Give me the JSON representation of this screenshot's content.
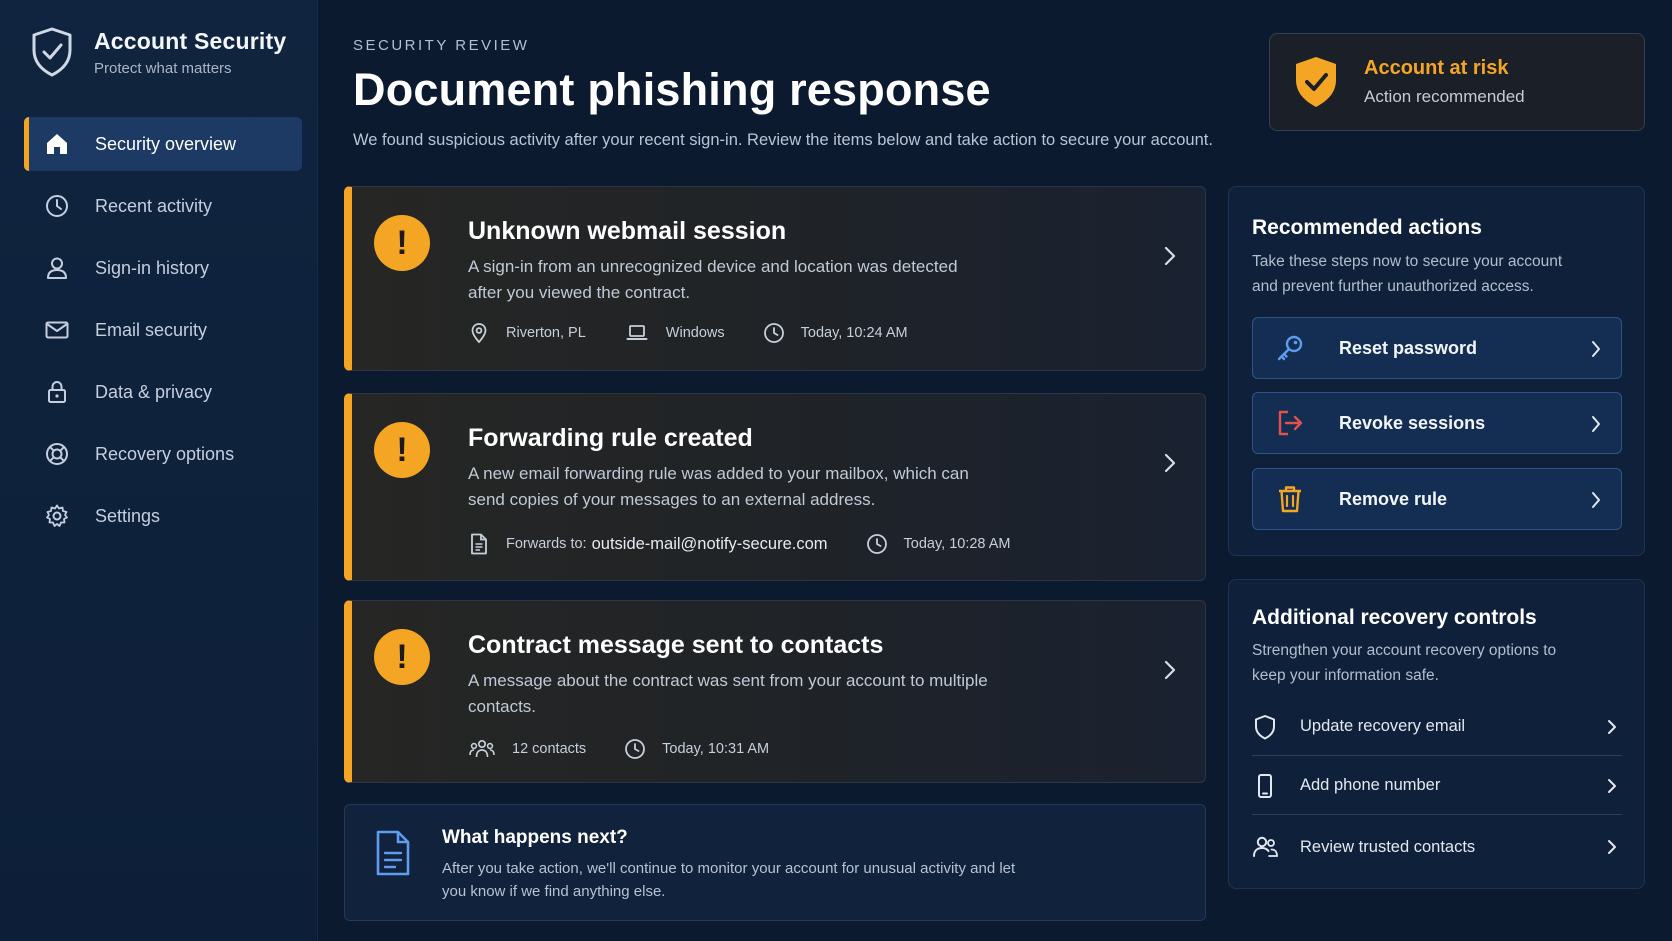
{
  "brand": {
    "title": "Account Security",
    "subtitle": "Protect what matters"
  },
  "nav": [
    {
      "label": "Security overview",
      "icon": "home-icon",
      "active": true
    },
    {
      "label": "Recent activity",
      "icon": "clock-icon",
      "active": false
    },
    {
      "label": "Sign-in history",
      "icon": "user-icon",
      "active": false
    },
    {
      "label": "Email security",
      "icon": "mail-icon",
      "active": false
    },
    {
      "label": "Data & privacy",
      "icon": "lock-icon",
      "active": false
    },
    {
      "label": "Recovery options",
      "icon": "lifebuoy-icon",
      "active": false
    },
    {
      "label": "Settings",
      "icon": "gear-icon",
      "active": false
    }
  ],
  "header": {
    "eyebrow": "SECURITY REVIEW",
    "title": "Document phishing response",
    "description": "We found suspicious activity after your recent sign-in. Review the items below and take action to secure your account."
  },
  "risk": {
    "title": "Account at risk",
    "subtitle": "Action recommended"
  },
  "alerts": [
    {
      "title": "Unknown webmail session",
      "description": "A sign-in from an unrecognized device and location was detected after you viewed the contract.",
      "meta": [
        {
          "icon": "location-pin-icon",
          "text": "Riverton, PL"
        },
        {
          "icon": "laptop-icon",
          "text": "Windows"
        },
        {
          "icon": "clock-icon",
          "text": "Today, 10:24 AM"
        }
      ]
    },
    {
      "title": "Forwarding rule created",
      "description": "A new email forwarding rule was added to your mailbox, which can send copies of your messages to an external address.",
      "meta": [
        {
          "icon": "document-icon",
          "text": "Forwards to:",
          "strong": "outside-mail@notify-secure.com"
        },
        {
          "icon": "clock-icon",
          "text": "Today, 10:28 AM"
        }
      ]
    },
    {
      "title": "Contract message sent to contacts",
      "description": "A message about the contract was sent from your account to multiple contacts.",
      "meta": [
        {
          "icon": "contacts-icon",
          "text": "12 contacts"
        },
        {
          "icon": "clock-icon",
          "text": "Today, 10:31 AM"
        }
      ]
    }
  ],
  "next": {
    "title": "What happens next?",
    "description": "After you take action, we'll continue to monitor your account for unusual activity and let you know if we find anything else."
  },
  "recommended": {
    "title": "Recommended actions",
    "description": "Take these steps now to secure your account and prevent further unauthorized access.",
    "actions": [
      {
        "label": "Reset password",
        "icon": "key-icon"
      },
      {
        "label": "Revoke sessions",
        "icon": "sign-out-icon"
      },
      {
        "label": "Remove rule",
        "icon": "trash-icon"
      }
    ]
  },
  "recovery": {
    "title": "Additional recovery controls",
    "description": "Strengthen your account recovery options to keep your information safe.",
    "items": [
      {
        "label": "Update recovery email",
        "icon": "shield-icon"
      },
      {
        "label": "Add phone number",
        "icon": "phone-icon"
      },
      {
        "label": "Review trusted contacts",
        "icon": "trusted-contacts-icon"
      }
    ]
  },
  "colors": {
    "accent": "#f5a524",
    "background": "#0c1a30",
    "danger": "#e0514d",
    "link": "#5e9cf0"
  }
}
